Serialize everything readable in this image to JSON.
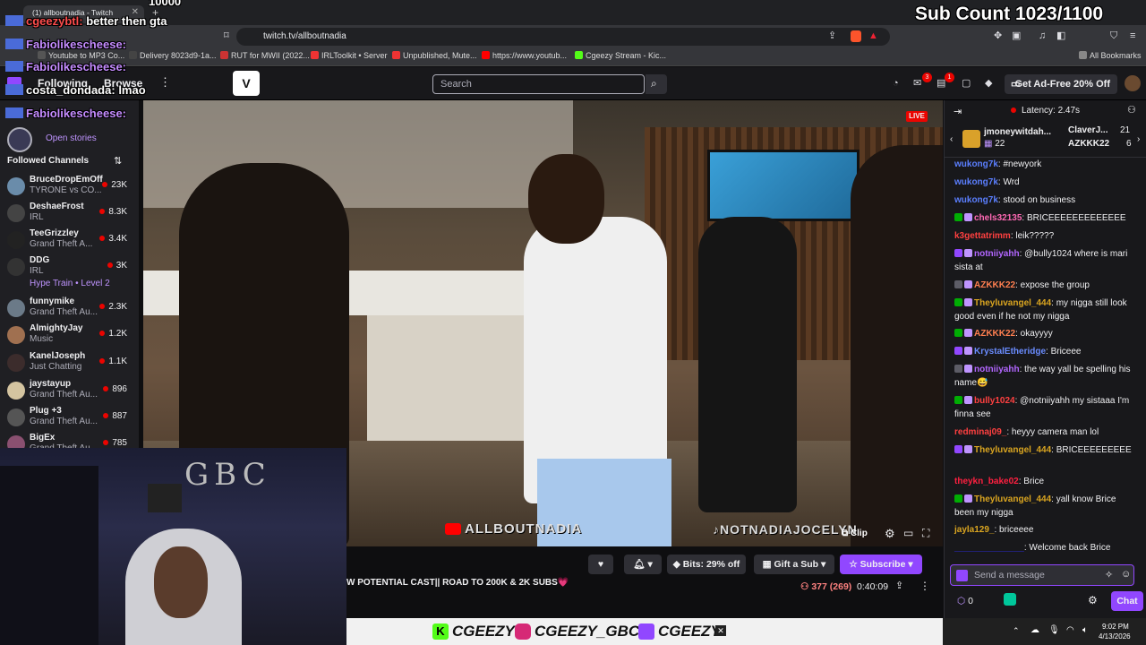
{
  "browser": {
    "tab_title": "(1) allboutnadia - Twitch",
    "url": "twitch.tv/allboutnadia",
    "bookmarks": [
      "Youtube to MP3 Co...",
      "Delivery 8023d9-1a...",
      "RUT for MWII (2022...",
      "IRLToolkit • Server",
      "Unpublished, Mute...",
      "https://www.youtub...",
      "Cgeezy Stream - Kic..."
    ],
    "all_bookmarks": "All Bookmarks"
  },
  "overlay": {
    "sub_count": "Sub Count 1023/1100",
    "top_number": "10000",
    "chat_lines": [
      {
        "user": "cgeezybtl:",
        "text": "better then gta",
        "color": "#ff4d4d"
      },
      {
        "user": "Fabiolikescheese:",
        "text": "",
        "color": "#c58cff"
      },
      {
        "user": "Fabiolikescheese:",
        "text": "",
        "color": "#c58cff"
      },
      {
        "user": "costa_dondada:",
        "text": "lmao",
        "color": "#ffffff"
      },
      {
        "user": "Fabiolikescheese:",
        "text": "",
        "color": "#c58cff"
      }
    ],
    "banner_items": [
      "CGEEZY",
      "CGEEZY_GBC",
      "CGEEZY"
    ],
    "webcam_sign": "GBC"
  },
  "topnav": {
    "following": "Following",
    "browse": "Browse",
    "search_placeholder": "Search",
    "ad_free": "Get Ad-Free 20% Off",
    "notif_badge_1": "3",
    "notif_badge_2": "1"
  },
  "sidebar": {
    "open_stories": "Open stories",
    "followed_title": "Followed Channels",
    "channels": [
      {
        "name": "BruceDropEmOff",
        "game": "TYRONE vs CO...",
        "viewers": "23K",
        "color": "#6a8caa"
      },
      {
        "name": "DeshaeFrost",
        "game": "IRL",
        "viewers": "8.3K",
        "color": "#444"
      },
      {
        "name": "TeeGrizzley",
        "game": "Grand Theft A...",
        "viewers": "3.4K",
        "color": "#222"
      },
      {
        "name": "DDG",
        "game": "IRL",
        "viewers": "3K",
        "color": "#333"
      },
      {
        "name": "funnymike",
        "game": "Grand Theft Au...",
        "viewers": "2.3K",
        "color": "#6b7a88"
      },
      {
        "name": "AlmightyJay",
        "game": "Music",
        "viewers": "1.2K",
        "color": "#a07050"
      },
      {
        "name": "KanelJoseph",
        "game": "Just Chatting",
        "viewers": "1.1K",
        "color": "#3c2c2c"
      },
      {
        "name": "jaystayup",
        "game": "Grand Theft Au...",
        "viewers": "896",
        "color": "#d4c4a0"
      },
      {
        "name": "Plug +3",
        "game": "Grand Theft Au...",
        "viewers": "887",
        "color": "#555"
      },
      {
        "name": "BigEx",
        "game": "Grand Theft Au...",
        "viewers": "785",
        "color": "#8a5070"
      }
    ],
    "hype_train": "Hype Train • Level 2"
  },
  "video": {
    "live_label": "LIVE",
    "watermark_left": "ALLBOUTNADIA",
    "watermark_right": "NOTNADIAJOCELYN",
    "clip_label": "Clip"
  },
  "info": {
    "title": "W POTENTIAL CAST|| ROAD TO 200K & 2K SUBS💗",
    "bits": "Bits: 29% off",
    "gift": "Gift a Sub",
    "subscribe": "Subscribe",
    "viewers": "377 (269)",
    "uptime": "0:40:09"
  },
  "chat": {
    "latency": "Latency: 2.47s",
    "gifters": [
      {
        "name": "jmoneywitdah...",
        "count": "22"
      },
      {
        "name": "ClaverJ...",
        "count": "21"
      },
      {
        "name": "AZKKK22",
        "count": "6"
      }
    ],
    "messages": [
      {
        "user": "wukong7k",
        "text": ": #newyork",
        "color": "#5b7fff"
      },
      {
        "user": "wukong7k",
        "text": ": Wrd",
        "color": "#5b7fff"
      },
      {
        "user": "wukong7k",
        "text": ": stood on business",
        "color": "#5b7fff"
      },
      {
        "user": "chels32135",
        "text": ": BRICEEEEEEEEEEEEE",
        "color": "#ff69b4"
      },
      {
        "user": "k3gettatrimm",
        "text": ": leik?????",
        "color": "#ff4040"
      },
      {
        "user": "notniiyahh",
        "text": ": @bully1024 where is mari sista at",
        "color": "#b266ff"
      },
      {
        "user": "AZKKK22",
        "text": ": expose the group",
        "color": "#ff7f50"
      },
      {
        "user": "Theyluvangel_444",
        "text": ": my nigga still look good even if he not my nigga",
        "color": "#daa520"
      },
      {
        "user": "AZKKK22",
        "text": ": okayyyy",
        "color": "#ff7f50"
      },
      {
        "user": "KrystalEtheridge",
        "text": ": Briceee",
        "color": "#6a8cff"
      },
      {
        "user": "notniiyahh",
        "text": ": the way yall be spelling his name😅",
        "color": "#b266ff"
      },
      {
        "user": "bully1024",
        "text": ": @notniiyahh my sistaaa I'm finna see",
        "color": "#ff4040"
      },
      {
        "user": "redminaj09_",
        "text": ": heyyy camera man lol",
        "color": "#ff4040"
      },
      {
        "user": "Theyluvangel_444",
        "text": ": BRICEEEEEEEEE",
        "color": "#daa520"
      },
      {
        "user": "theykn_bake02",
        "text": ": Brice",
        "color": "#ff2040"
      },
      {
        "user": "Theyluvangel_444",
        "text": ": yall know Brice been my nigga",
        "color": "#daa520"
      },
      {
        "user": "jayla129_",
        "text": ": briceeee",
        "color": "#daa520"
      },
      {
        "user": "______________",
        "text": ": Welcome back Brice",
        "color": "#3030ff"
      }
    ],
    "send_placeholder": "Send a message",
    "points": "0",
    "chat_button": "Chat"
  },
  "taskbar": {
    "time": "9:02 PM",
    "date": "4/13/2026"
  }
}
